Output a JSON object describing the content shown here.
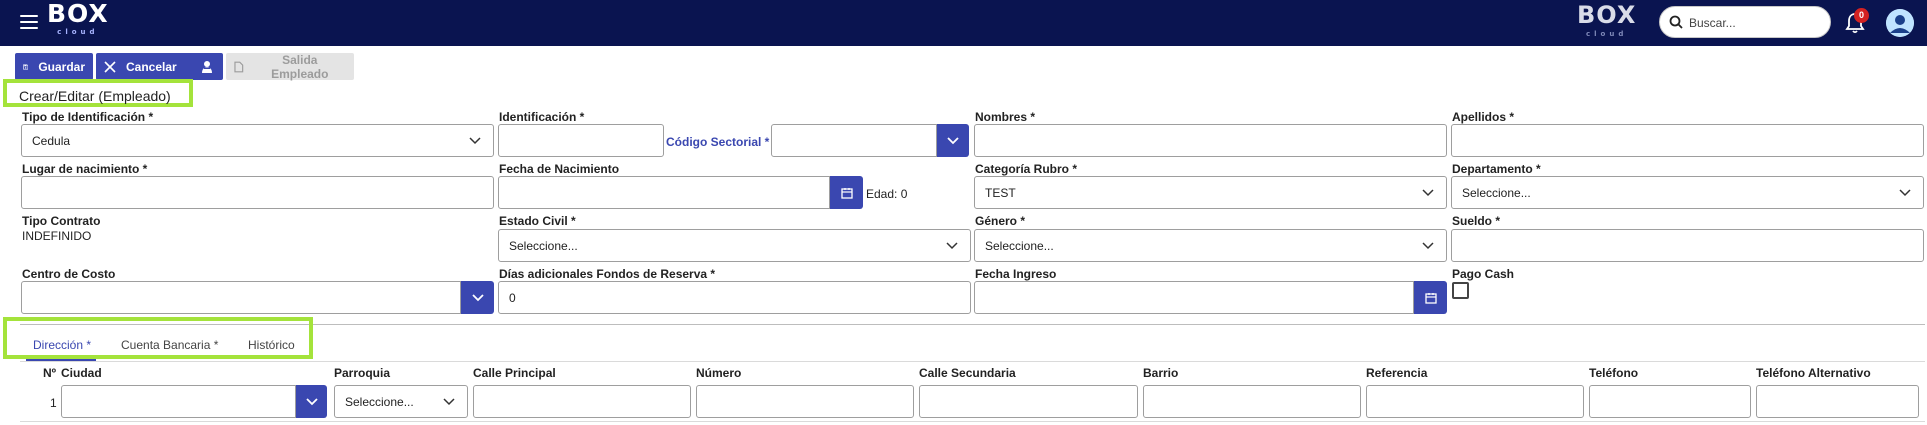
{
  "header": {
    "logo_text": "BOX",
    "logo_sub": "cloud",
    "search_placeholder": "Buscar...",
    "notification_count": "0",
    "brand_color": "#0a1450"
  },
  "toolbar": {
    "save_label": "Guardar",
    "cancel_label": "Cancelar",
    "exit_label": "Salida Empleado"
  },
  "page_title": "Crear/Editar (Empleado)",
  "form": {
    "tipo_identificacion": {
      "label": "Tipo de Identificación *",
      "value": "Cedula"
    },
    "identificacion": {
      "label": "Identificación *",
      "value": ""
    },
    "codigo_sectorial": {
      "label": "Código Sectorial *",
      "value": ""
    },
    "nombres": {
      "label": "Nombres *",
      "value": ""
    },
    "apellidos": {
      "label": "Apellidos *",
      "value": ""
    },
    "lugar_nacimiento": {
      "label": "Lugar de nacimiento *",
      "value": ""
    },
    "fecha_nacimiento": {
      "label": "Fecha de Nacimiento",
      "value": ""
    },
    "edad": "Edad: 0",
    "categoria_rubro": {
      "label": "Categoría Rubro *",
      "value": "TEST"
    },
    "departamento": {
      "label": "Departamento *",
      "value": "Seleccione..."
    },
    "tipo_contrato": {
      "label": "Tipo Contrato",
      "value": "INDEFINIDO"
    },
    "estado_civil": {
      "label": "Estado Civil *",
      "value": "Seleccione..."
    },
    "genero": {
      "label": "Género *",
      "value": "Seleccione..."
    },
    "sueldo": {
      "label": "Sueldo *",
      "value": ""
    },
    "centro_costo": {
      "label": "Centro de Costo",
      "value": ""
    },
    "dias_fondos_reserva": {
      "label": "Días adicionales Fondos de Reserva *",
      "value": "0"
    },
    "fecha_ingreso": {
      "label": "Fecha Ingreso",
      "value": ""
    },
    "pago_cash": {
      "label": "Pago Cash",
      "checked": false
    }
  },
  "tabs": [
    {
      "label": "Dirección *",
      "active": true
    },
    {
      "label": "Cuenta Bancaria *",
      "active": false
    },
    {
      "label": "Histórico",
      "active": false
    }
  ],
  "address_table": {
    "columns": [
      "Nº",
      "Ciudad",
      "Parroquia",
      "Calle Principal",
      "Número",
      "Calle Secundaria",
      "Barrio",
      "Referencia",
      "Teléfono",
      "Teléfono Alternativo"
    ],
    "rows": [
      {
        "n": "1",
        "ciudad": "",
        "parroquia": "Seleccione...",
        "calle_principal": "",
        "numero": "",
        "calle_secundaria": "",
        "barrio": "",
        "referencia": "",
        "telefono": "",
        "telefono_alternativo": ""
      }
    ]
  },
  "colors": {
    "accent": "#3a47b0",
    "highlight": "#a4e33b"
  }
}
